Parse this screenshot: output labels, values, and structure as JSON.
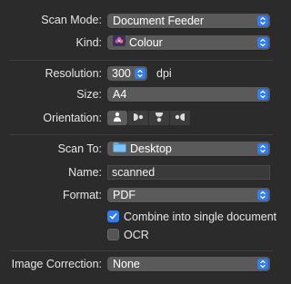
{
  "scan_mode": {
    "label": "Scan Mode:",
    "value": "Document Feeder"
  },
  "kind": {
    "label": "Kind:",
    "value": "Colour",
    "icon": "flower-icon"
  },
  "resolution": {
    "label": "Resolution:",
    "value": "300",
    "unit": "dpi"
  },
  "size": {
    "label": "Size:",
    "value": "A4"
  },
  "orientation": {
    "label": "Orientation:",
    "options": [
      "upright",
      "rotate-left",
      "upside-down",
      "rotate-right"
    ],
    "selected_index": 0
  },
  "scan_to": {
    "label": "Scan To:",
    "value": "Desktop",
    "icon": "folder-icon"
  },
  "name": {
    "label": "Name:",
    "value": "scanned"
  },
  "format": {
    "label": "Format:",
    "value": "PDF"
  },
  "combine": {
    "label": "Combine into single document",
    "checked": true
  },
  "ocr": {
    "label": "OCR",
    "checked": false
  },
  "image_correction": {
    "label": "Image Correction:",
    "value": "None"
  },
  "colors": {
    "accent": "#2f7df6",
    "background": "#2b2b2b",
    "control": "#5a5a5a"
  }
}
